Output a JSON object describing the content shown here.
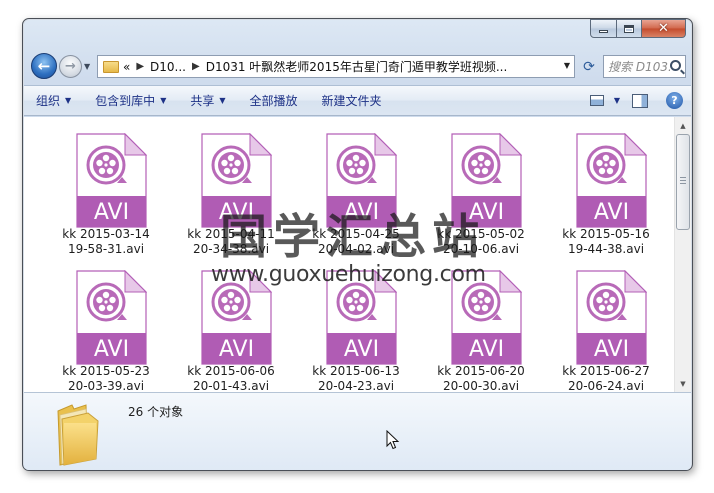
{
  "window": {
    "address": {
      "back_glyph": "«",
      "crumb1": "D10...",
      "crumb2": "D1031 叶飘然老师2015年古星门奇门遁甲教学班视频..."
    },
    "search_placeholder": "搜索 D103...",
    "commands": [
      {
        "label": "组织",
        "has_dropdown": true
      },
      {
        "label": "包含到库中",
        "has_dropdown": true
      },
      {
        "label": "共享",
        "has_dropdown": true
      },
      {
        "label": "全部播放",
        "has_dropdown": false
      },
      {
        "label": "新建文件夹",
        "has_dropdown": false
      }
    ]
  },
  "file_badge": "AVI",
  "files": [
    {
      "line1": "kk 2015-03-14",
      "line2": "19-58-31.avi"
    },
    {
      "line1": "kk 2015-04-11",
      "line2": "20-34-38.avi"
    },
    {
      "line1": "kk 2015-04-25",
      "line2": "20-04-02.avi"
    },
    {
      "line1": "kk 2015-05-02",
      "line2": "20-10-06.avi"
    },
    {
      "line1": "kk 2015-05-16",
      "line2": "19-44-38.avi"
    },
    {
      "line1": "kk 2015-05-23",
      "line2": "20-03-39.avi"
    },
    {
      "line1": "kk 2015-06-06",
      "line2": "20-01-43.avi"
    },
    {
      "line1": "kk 2015-06-13",
      "line2": "20-04-23.avi"
    },
    {
      "line1": "kk 2015-06-20",
      "line2": "20-00-30.avi"
    },
    {
      "line1": "kk 2015-06-27",
      "line2": "20-06-24.avi"
    }
  ],
  "details": {
    "count_label": "26 个对象"
  },
  "watermark": {
    "title": "国学汇总站",
    "url": "www.guoxuehuizong.com"
  },
  "colors": {
    "avi_band": "#b05cb4",
    "avi_icon": "#b86ab8",
    "window_border": "#4a4f57",
    "command_text": "#1e3287"
  }
}
